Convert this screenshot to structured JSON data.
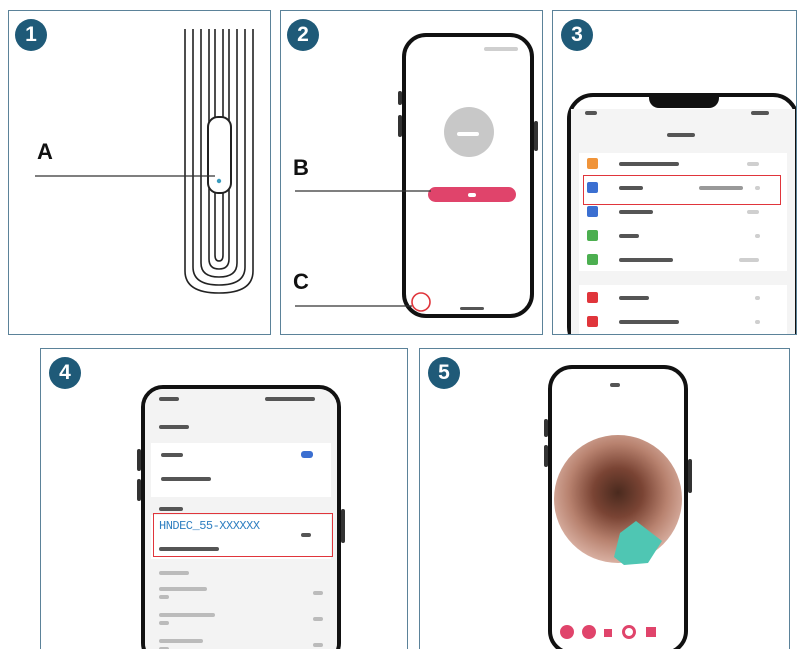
{
  "steps": [
    {
      "number": "1",
      "labels": {
        "a": "A"
      }
    },
    {
      "number": "2",
      "labels": {
        "b": "B",
        "c": "C"
      }
    },
    {
      "number": "3"
    },
    {
      "number": "4",
      "wifi_ssid": "HNDEC_55-XXXXXX"
    },
    {
      "number": "5"
    }
  ],
  "colors": {
    "panel_border": "#5b8299",
    "badge": "#1f5a78",
    "highlight": "#e0353b",
    "app_button": "#e0446b",
    "wifi_text": "#2f7fc1",
    "teal_overlay": "#4fc6b3"
  },
  "icons": [
    "camera-avatar-icon",
    "settings-row-icon",
    "wifi-icon",
    "record-icon",
    "snapshot-icon"
  ]
}
